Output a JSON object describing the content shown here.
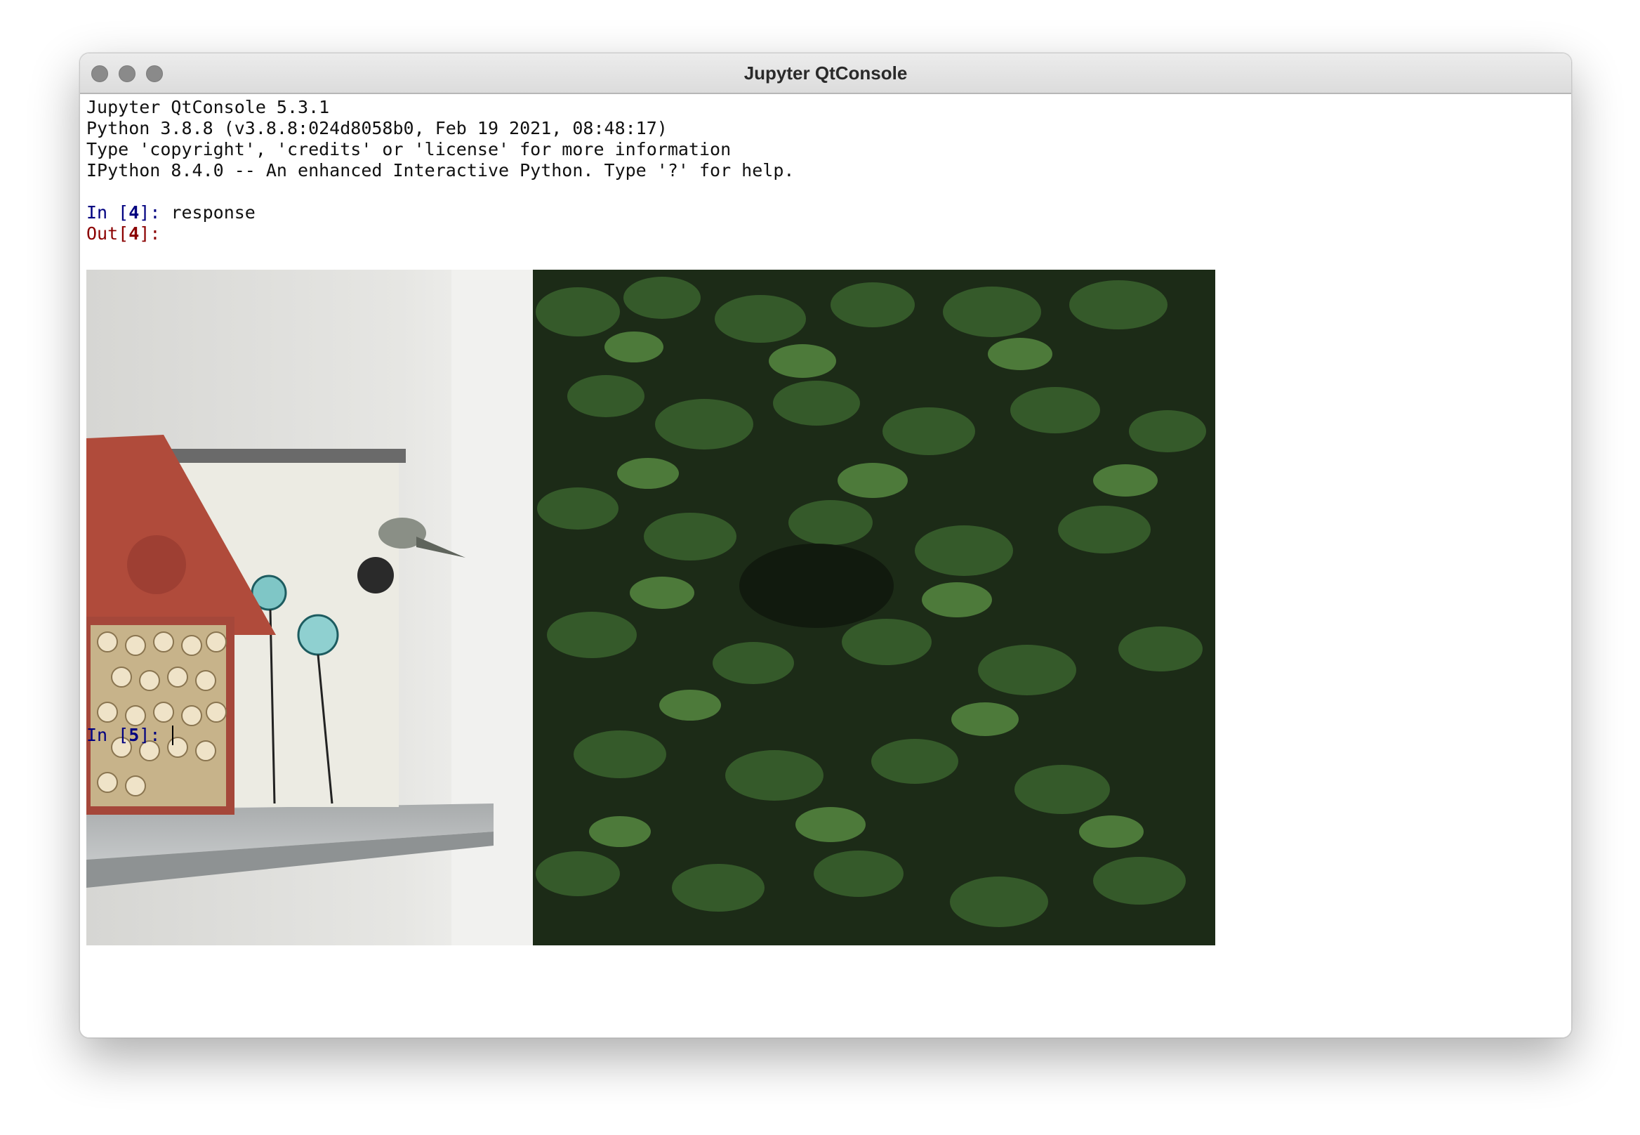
{
  "window": {
    "title": "Jupyter QtConsole"
  },
  "console": {
    "banner": [
      "Jupyter QtConsole 5.3.1",
      "Python 3.8.8 (v3.8.8:024d8058b0, Feb 19 2021, 08:48:17)",
      "Type 'copyright', 'credits' or 'license' for more information",
      "IPython 8.4.0 -- An enhanced Interactive Python. Type '?' for help."
    ],
    "cell_in": {
      "prefix": "In [",
      "number": "4",
      "suffix": "]: ",
      "code": "response"
    },
    "cell_out": {
      "prefix": "Out[",
      "number": "4",
      "suffix": "]:"
    },
    "next_prompt": {
      "prefix": "In [",
      "number": "5",
      "suffix": "]: ",
      "value": ""
    }
  },
  "colors": {
    "prompt_in": "#000080",
    "prompt_out": "#8b0000"
  }
}
